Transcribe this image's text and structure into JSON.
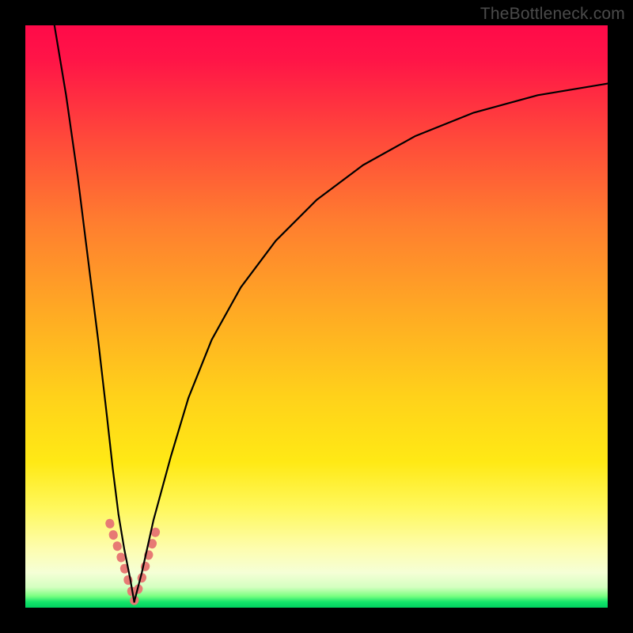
{
  "watermark": "TheBottleneck.com",
  "chart_data": {
    "type": "line",
    "title": "",
    "xlabel": "",
    "ylabel": "",
    "xlim": [
      0,
      100
    ],
    "ylim": [
      0,
      100
    ],
    "grid": false,
    "legend": false,
    "background_gradient": {
      "top": "#ff0a49",
      "middle": "#ffe915",
      "bottom": "#00d060",
      "meaning": "red high → green low"
    },
    "series": [
      {
        "name": "left-branch",
        "stroke": "#000000",
        "x": [
          5,
          7,
          9,
          11,
          12.5,
          14,
          15,
          16,
          17,
          18,
          18.7
        ],
        "y": [
          100,
          88,
          74,
          58,
          46,
          33,
          24,
          16,
          10,
          5,
          1
        ]
      },
      {
        "name": "right-branch",
        "stroke": "#000000",
        "x": [
          18.7,
          20,
          22,
          25,
          28,
          32,
          37,
          43,
          50,
          58,
          67,
          77,
          88,
          100
        ],
        "y": [
          1,
          6,
          15,
          26,
          36,
          46,
          55,
          63,
          70,
          76,
          81,
          85,
          88,
          90
        ]
      },
      {
        "name": "highlight-left",
        "stroke": "#e77a74",
        "width": 11,
        "x": [
          14.5,
          15.2,
          16.0,
          16.8,
          17.5,
          18.2,
          18.7
        ],
        "y": [
          14.5,
          12.2,
          10.0,
          7.5,
          5.2,
          3.0,
          1.2
        ]
      },
      {
        "name": "highlight-right",
        "stroke": "#e77a74",
        "width": 11,
        "x": [
          18.7,
          19.5,
          20.3,
          21.0,
          21.8,
          22.5
        ],
        "y": [
          1.2,
          3.5,
          6.0,
          8.5,
          11.0,
          13.5
        ]
      }
    ],
    "notch_min": {
      "x": 18.7,
      "y": 1
    }
  }
}
